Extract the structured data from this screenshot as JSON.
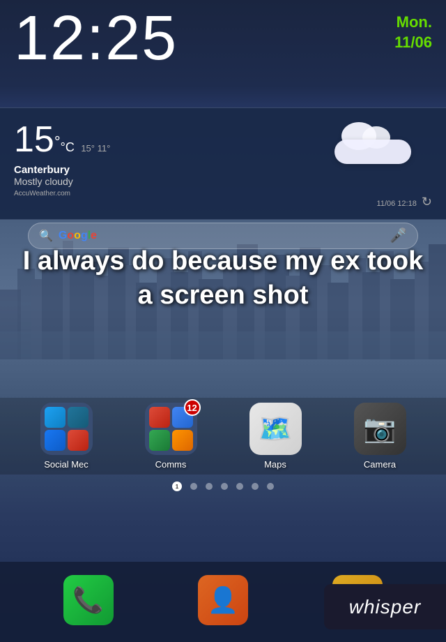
{
  "phone": {
    "time": "12:25",
    "day": "Mon.",
    "date": "11/06"
  },
  "weather": {
    "temp": "15",
    "unit_c": "°C",
    "high": "15°",
    "low": "11°",
    "city": "Canterbury",
    "description": "Mostly cloudy",
    "brand": "AccuWeather.com",
    "timestamp": "11/06 12:18"
  },
  "overlay": {
    "text": "I always do because my ex took a screen shot"
  },
  "apps": [
    {
      "label": "Social Mec",
      "has_badge": false
    },
    {
      "label": "Comms",
      "has_badge": true,
      "badge_count": "12"
    },
    {
      "label": "Maps",
      "has_badge": false
    },
    {
      "label": "Camera",
      "has_badge": false
    }
  ],
  "page_dots": {
    "count": 7,
    "active_index": 0,
    "numbered_index": 0,
    "number": "1"
  },
  "whisper": {
    "label": "whisper"
  },
  "search": {
    "google_label": "Google"
  }
}
